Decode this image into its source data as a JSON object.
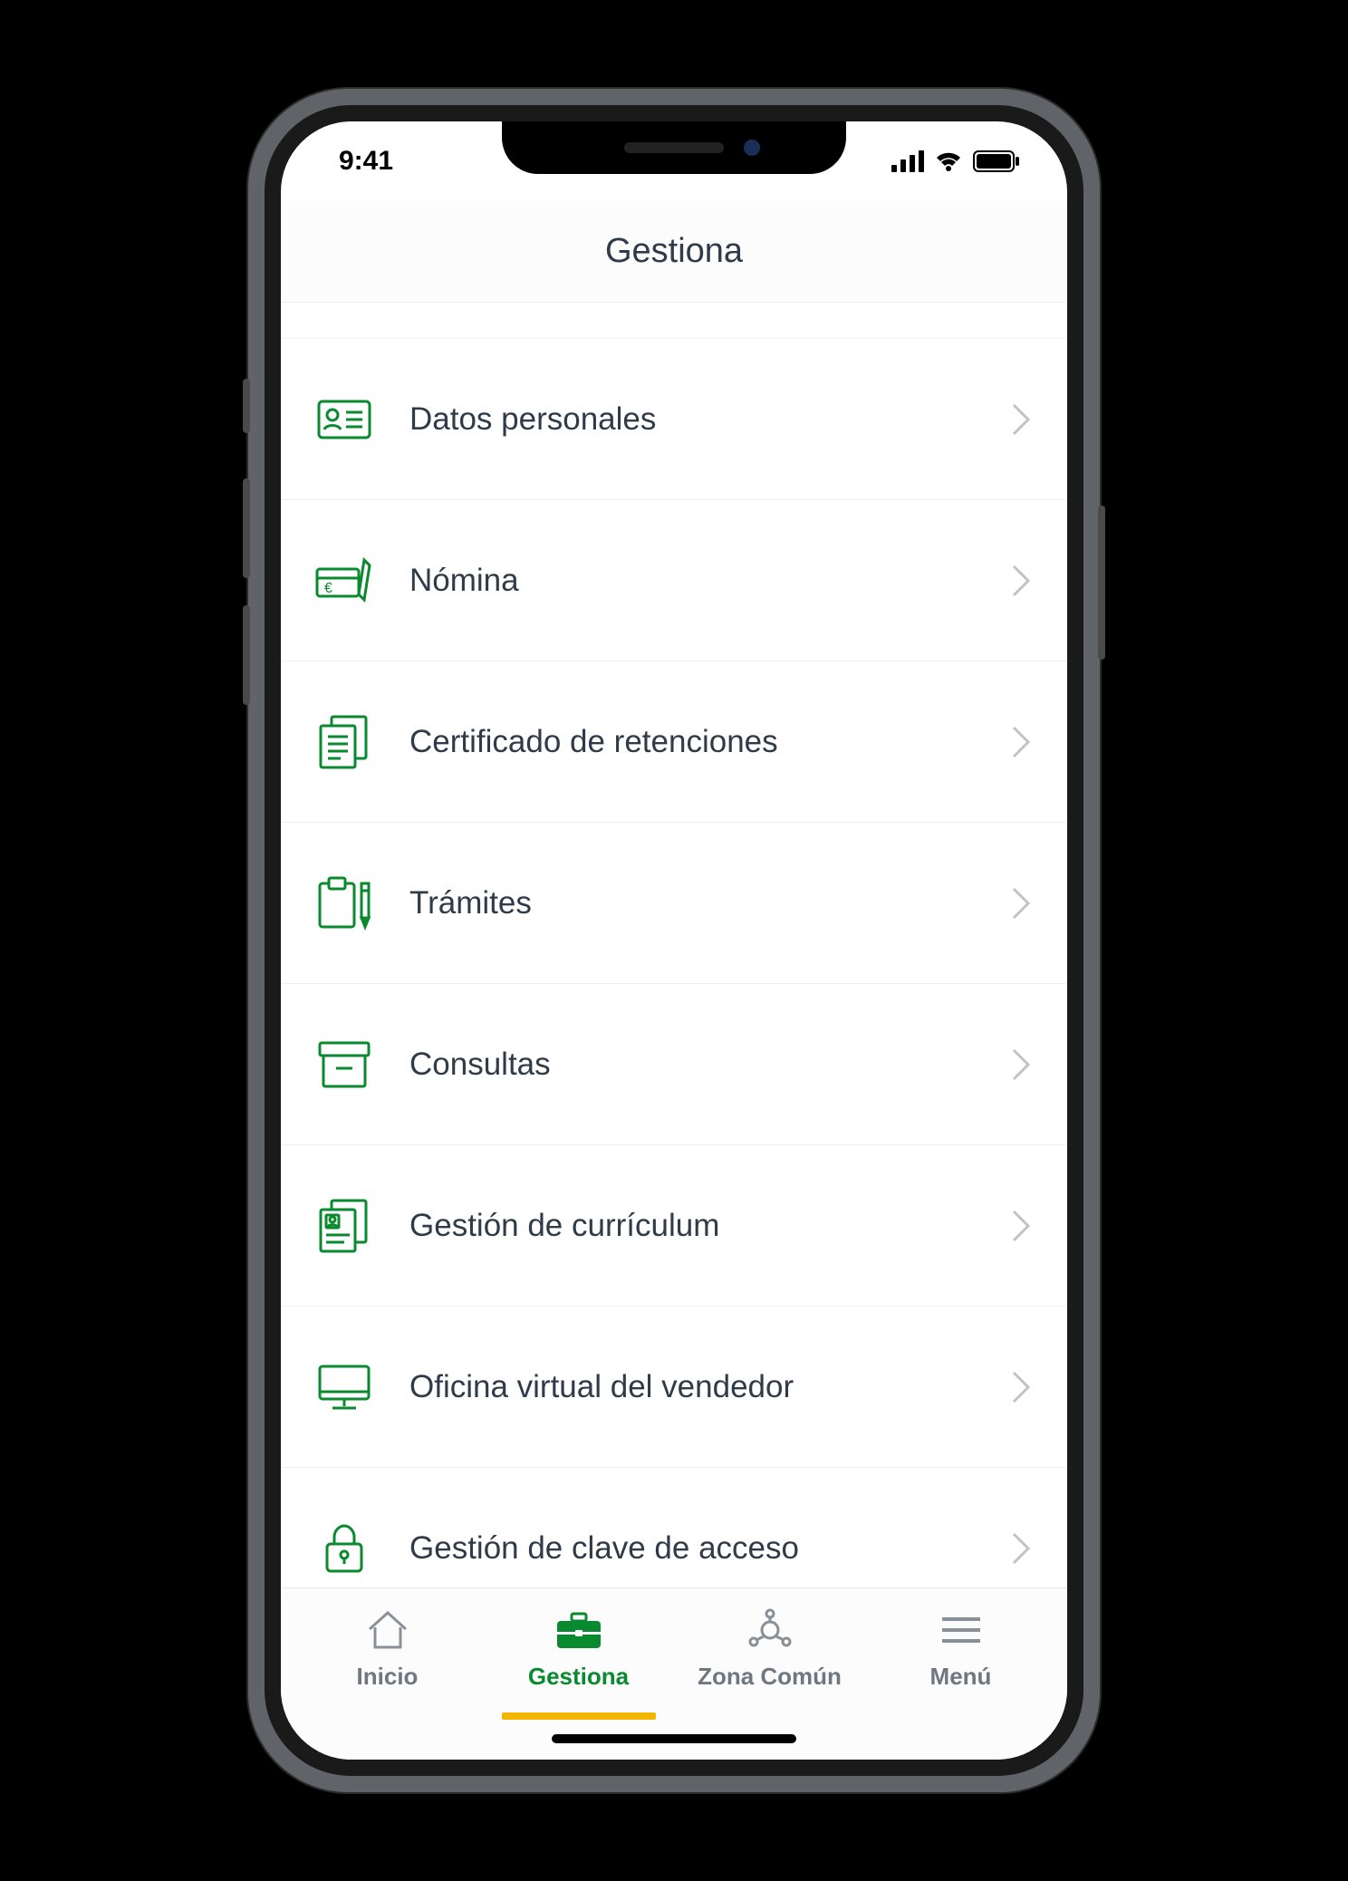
{
  "status": {
    "time": "9:41"
  },
  "header": {
    "title": "Gestiona"
  },
  "accent": "#0a8a2f",
  "items": [
    {
      "icon": "id-card-icon",
      "label": "Datos personales"
    },
    {
      "icon": "payslip-icon",
      "label": "Nómina"
    },
    {
      "icon": "documents-icon",
      "label": "Certificado de retenciones"
    },
    {
      "icon": "clipboard-pencil-icon",
      "label": "Trámites"
    },
    {
      "icon": "archive-box-icon",
      "label": "Consultas"
    },
    {
      "icon": "resume-icon",
      "label": "Gestión de currículum"
    },
    {
      "icon": "desktop-monitor-icon",
      "label": "Oficina virtual del vendedor"
    },
    {
      "icon": "lock-icon",
      "label": "Gestión de clave de acceso"
    }
  ],
  "nav": [
    {
      "icon": "home-icon",
      "label": "Inicio",
      "active": false
    },
    {
      "icon": "briefcase-icon",
      "label": "Gestiona",
      "active": true
    },
    {
      "icon": "network-nodes-icon",
      "label": "Zona Común",
      "active": false
    },
    {
      "icon": "menu-icon",
      "label": "Menú",
      "active": false
    }
  ]
}
